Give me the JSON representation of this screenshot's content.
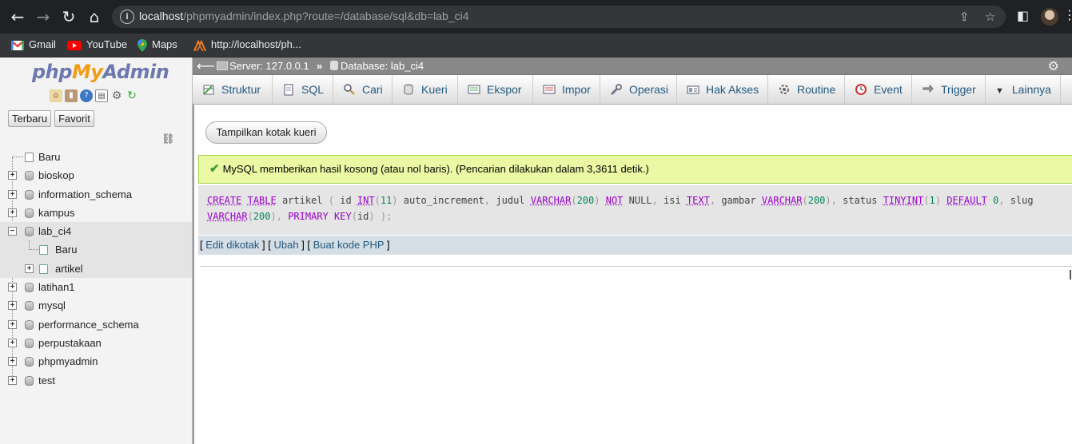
{
  "browser": {
    "url_host": "localhost",
    "url_path": "/phpmyadmin/index.php?route=/database/sql&db=lab_ci4",
    "bookmarks": [
      "Gmail",
      "YouTube",
      "Maps",
      "http://localhost/ph..."
    ]
  },
  "left_panel": {
    "logo": {
      "php": "php",
      "my": "My",
      "admin": "Admin"
    },
    "buttons": [
      "Terbaru",
      "Favorit"
    ],
    "tree": [
      {
        "label": "Baru",
        "type": "new"
      },
      {
        "label": "bioskop",
        "type": "db"
      },
      {
        "label": "information_schema",
        "type": "db"
      },
      {
        "label": "kampus",
        "type": "db"
      },
      {
        "label": "lab_ci4",
        "type": "db",
        "expanded": true
      },
      {
        "label": "Baru",
        "type": "child-new"
      },
      {
        "label": "artikel",
        "type": "child-table"
      },
      {
        "label": "latihan1",
        "type": "db"
      },
      {
        "label": "mysql",
        "type": "db"
      },
      {
        "label": "performance_schema",
        "type": "db"
      },
      {
        "label": "perpustakaan",
        "type": "db"
      },
      {
        "label": "phpmyadmin",
        "type": "db"
      },
      {
        "label": "test",
        "type": "db"
      }
    ]
  },
  "breadcrumb": {
    "server": "Server: 127.0.0.1",
    "separator": "»",
    "database": "Database: lab_ci4"
  },
  "menu": [
    "Struktur",
    "SQL",
    "Cari",
    "Kueri",
    "Ekspor",
    "Impor",
    "Operasi",
    "Hak Akses",
    "Routine",
    "Event",
    "Trigger",
    "Lainnya"
  ],
  "query_box_button": "Tampilkan kotak kueri",
  "success_message": "MySQL memberikan hasil kosong (atau nol baris). (Pencarian dilakukan dalam 3,3611 detik.)",
  "sql": {
    "line1": "CREATE TABLE artikel ( id INT(11) auto_increment, judul VARCHAR(200) NOT NULL, isi TEXT, gambar VARCHAR(200), status TINYINT(1) DEFAULT 0, slug",
    "line2": "VARCHAR(200), PRIMARY KEY(id) );"
  },
  "edit_links": {
    "edit_inline": "Edit dikotak",
    "edit": "Ubah",
    "php": "Buat kode PHP"
  }
}
